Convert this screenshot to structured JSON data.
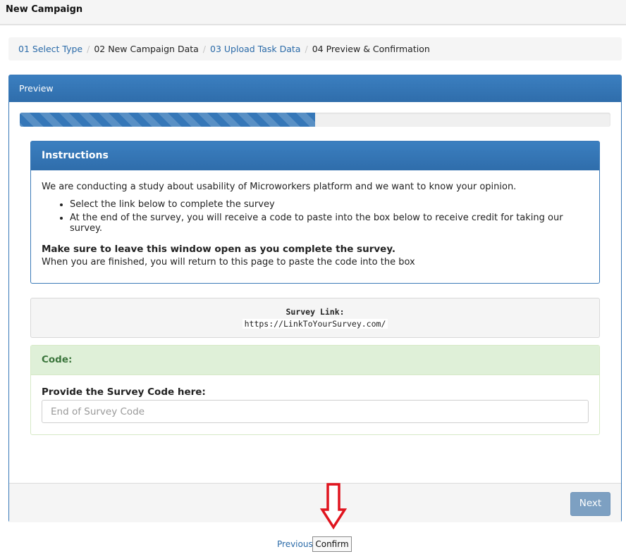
{
  "window": {
    "title": "New Campaign"
  },
  "breadcrumb": {
    "steps": [
      {
        "label": "01 Select Type"
      },
      {
        "label": "02 New Campaign Data"
      },
      {
        "label": "03 Upload Task Data"
      },
      {
        "label": "04 Preview & Confirmation"
      }
    ],
    "separator": "/"
  },
  "panel": {
    "title": "Preview",
    "progress_fraction": 0.5
  },
  "instructions": {
    "title": "Instructions",
    "intro": "We are conducting a study about usability of Microworkers platform and we want to know your opinion.",
    "bullets": [
      "Select the link below to complete the survey",
      "At the end of the survey, you will receive a code to paste into the box below to receive credit for taking our survey."
    ],
    "bold_note": "Make sure to leave this window open as you complete the survey.",
    "after_note": "When you are finished, you will return to this page to paste the code into the box"
  },
  "survey": {
    "label": "Survey Link:",
    "url": "https://LinkToYourSurvey.com/"
  },
  "code": {
    "title": "Code:",
    "question": "Provide the Survey Code here:",
    "placeholder": "End of Survey Code",
    "value": ""
  },
  "footer": {
    "next_label": "Next"
  },
  "bottom": {
    "previous_label": "Previous",
    "confirm_label": "Confirm"
  },
  "colors": {
    "accent": "#3577b8",
    "success_bg": "#dff0d8",
    "arrow": "#e0141e"
  }
}
